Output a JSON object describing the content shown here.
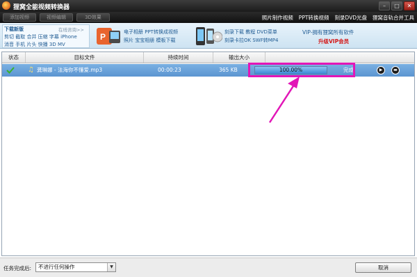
{
  "window": {
    "title": "狸窝全能视频转换器",
    "controls": [
      "minimize",
      "maximize",
      "close"
    ]
  },
  "toolbar": {
    "buttons": [
      "添加视频",
      "视频编辑",
      "3D效果"
    ],
    "links": [
      "照片制作视频",
      "PPT转换视频",
      "刻录DVD光盘",
      "狸窝音轨合并工具"
    ]
  },
  "banner": {
    "left": {
      "title": "下载新版",
      "online_help": "在线咨询>>",
      "row1": "剪切 截取 合并 压缩 字幕 iPhone",
      "row2": "消音 手机 片头 快播 3D MV"
    },
    "ppt_ad": {
      "line1": "电子相册 PPT转换成视频",
      "line2": "照片 宝宝相册 模板下载"
    },
    "phone_ad": {
      "line1": "刻录下载 教程 DVD菜单",
      "line2": "刻录卡拉OK SWF转MP4"
    },
    "vip": {
      "line1": "VIP-拥有狸窝所有软件",
      "line2": "升级VIP会员"
    }
  },
  "table": {
    "headers": [
      "状态",
      "目标文件",
      "持续时间",
      "输出大小"
    ],
    "rows": [
      {
        "file": "龚琳娜 - 法海你不懂爱.mp3",
        "duration": "00:00:23",
        "size": "365 KB",
        "progress_label": "100.00%",
        "progress": 100,
        "status": "完成"
      }
    ]
  },
  "bottom": {
    "after_label": "任务完成后:",
    "after_select": "不进行任何操作",
    "cancel_label": "取消"
  },
  "colors": {
    "highlight": "#e216b7",
    "row_selected": "#5b95d1",
    "vip_red": "#d31616"
  }
}
